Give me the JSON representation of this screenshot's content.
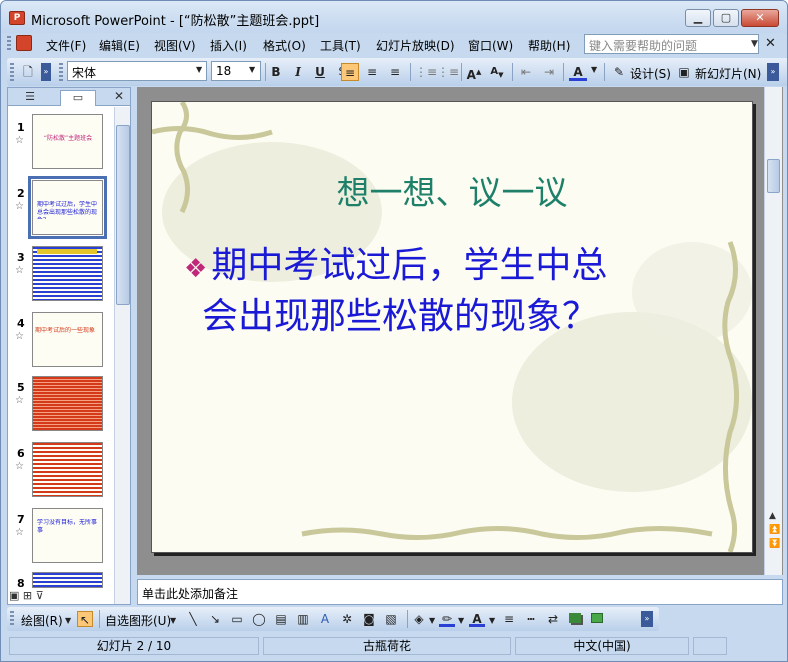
{
  "window": {
    "app_icon": "powerpoint-icon",
    "title": "Microsoft PowerPoint - [“防松散”主题班会.ppt]",
    "minimize": "minimize-icon",
    "maximize": "maximize-icon",
    "close": "close-icon"
  },
  "menu": {
    "items": [
      "文件(F)",
      "编辑(E)",
      "视图(V)",
      "插入(I)",
      "格式(O)",
      "工具(T)",
      "幻灯片放映(D)",
      "窗口(W)",
      "帮助(H)"
    ],
    "help_placeholder": "键入需要帮助的问题"
  },
  "toolbar": {
    "font": "宋体",
    "size": "18",
    "design": "设计(S)",
    "new_slide": "新幻灯片(N)"
  },
  "sidepanel": {
    "slides": [
      {
        "num": "1",
        "text": "“防松散”主题班会"
      },
      {
        "num": "2",
        "text": "期中考试过后，学生中总会出现那些松散的现象？"
      },
      {
        "num": "3",
        "text": ""
      },
      {
        "num": "4",
        "text": "期中考试后的一些现象"
      },
      {
        "num": "5",
        "text": ""
      },
      {
        "num": "6",
        "text": ""
      },
      {
        "num": "7",
        "text": "学习没有目标，无所事事"
      },
      {
        "num": "8",
        "text": ""
      }
    ]
  },
  "slide": {
    "title": "想一想、议一议",
    "line1": "期中考试过后，学生中总",
    "line2": "会出现那些松散的现象？"
  },
  "notes": {
    "placeholder": "单击此处添加备注"
  },
  "drawing": {
    "draw_label": "绘图(R)",
    "autoshapes": "自选图形(U)"
  },
  "status": {
    "slide_pos": "幻灯片 2 / 10",
    "design": "古瓶荷花",
    "language": "中文(中国)"
  },
  "colors": {
    "title_text": "#1e8069",
    "body_text": "#1a1ad6",
    "bullet": "#c0287a",
    "ui_bg": "#c7d9ee"
  }
}
